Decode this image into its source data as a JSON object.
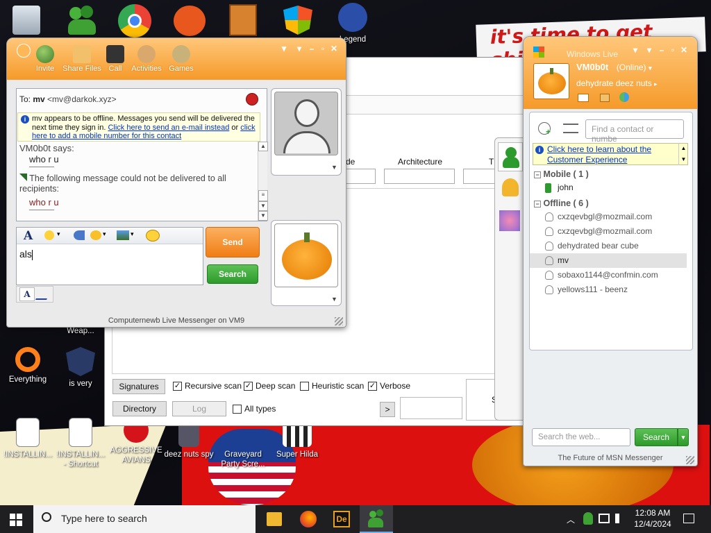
{
  "desktop": {
    "wallpaper_text": "it's time to get shit",
    "icons": [
      {
        "label": "Legend",
        "icon": "game-character-icon"
      },
      {
        "label": "Weap...",
        "icon": "weapon-icon"
      },
      {
        "label": "Everything",
        "icon": "everything-search-icon"
      },
      {
        "label": "is very",
        "icon": "shield-logo-icon"
      },
      {
        "label": "!INSTALLIN...",
        "icon": "document-icon"
      },
      {
        "label": "!INSTALLIN... - Shortcut",
        "icon": "document-shortcut-icon"
      },
      {
        "label": "AGGRESSIVE AVIANS",
        "icon": "angry-bird-icon"
      },
      {
        "label": "deez nuts spy",
        "icon": "spy-icon"
      },
      {
        "label": "Graveyard Party Scre...",
        "icon": "graveyard-icon"
      },
      {
        "label": "Super Hilda",
        "icon": "pixel-game-icon"
      }
    ]
  },
  "messenger": {
    "toolbar": [
      "Invite",
      "Share Files",
      "Call",
      "Activities",
      "Games"
    ],
    "to_label": "To:",
    "to_name": "mv",
    "to_email": "<mv@darkok.xyz>",
    "offline_notice": "mv appears to be offline. Messages you send will be delivered the next time they sign in.",
    "offline_link1": "Click here to send an e-mail instead",
    "offline_or": "or",
    "offline_link2": "click here to add a mobile number for this contact",
    "says_header": "VM0b0t says:",
    "says_msg": "who r u",
    "error_msg": "The following message could not be delivered to all recipients:",
    "error_quote": "who r u",
    "input_text": "als",
    "send_label": "Send",
    "search_label": "Search",
    "status_bar": "Computernewb Live Messenger on VM9"
  },
  "avast": {
    "col_partial": "de",
    "col_arch": "Architecture",
    "col_partial2": "T",
    "signatures_btn": "Signatures",
    "directory_btn": "Directory",
    "log_btn": "Log",
    "recursive_label": "Recursive scan",
    "deep_label": "Deep scan",
    "heuristic_label": "Heuristic scan",
    "verbose_label": "Verbose",
    "all_types_label": "All types",
    "next_btn": ">",
    "side_letter": "S"
  },
  "wlm": {
    "title": "Windows Live",
    "user_name": "VM0b0t",
    "status": "(Online)",
    "personal_message": "dehydrate deez nuts",
    "search_placeholder": "Find a contact or numbe",
    "banner_line1": "Click here to learn about the",
    "banner_line2": "Customer Experience",
    "group_mobile": "Mobile ( 1 )",
    "group_offline": "Offline ( 6 )",
    "mobile_contacts": [
      "john"
    ],
    "offline_contacts": [
      "cxzqevbgl@mozmail.com",
      "cxzqevbgl@mozmail.com",
      "dehydrated bear cube",
      "mv",
      "sobaxo1144@confmin.com",
      "yellows111 - beenz"
    ],
    "web_search_placeholder": "Search the web...",
    "web_search_btn": "Search",
    "footer": "The Future of MSN Messenger"
  },
  "taskbar": {
    "search_placeholder": "Type here to search",
    "time": "12:08 AM",
    "date": "12/4/2024"
  },
  "colors": {
    "orange": "#f59a2a",
    "send_orange": "#f7922b",
    "search_green": "#3ea83a",
    "link_blue": "#0033cc"
  }
}
